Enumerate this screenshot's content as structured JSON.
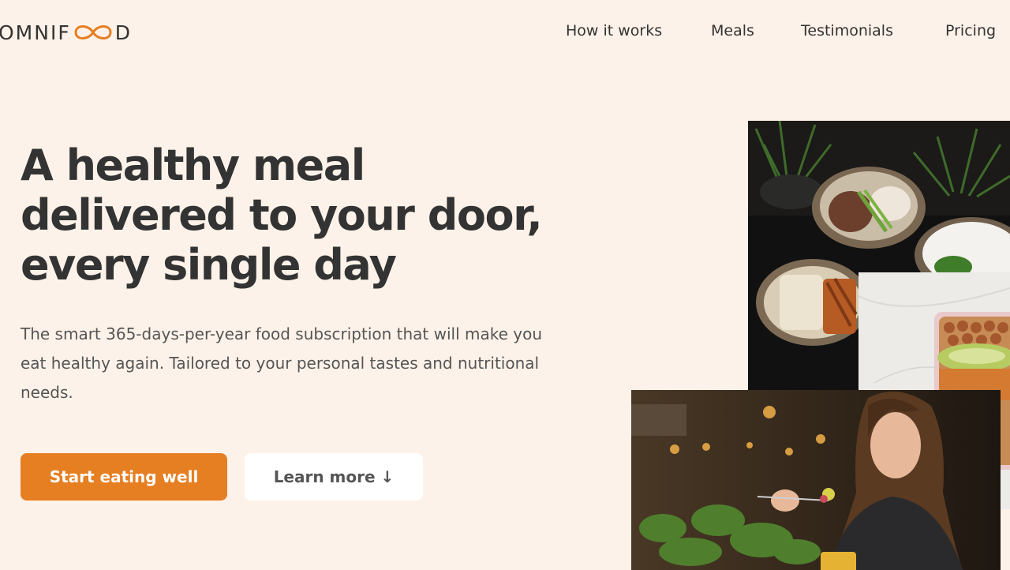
{
  "header": {
    "logo": {
      "prefix": "OMNIF",
      "suffix": "D",
      "mark_icon": "infinity-icon",
      "accent_color": "#e67e22"
    },
    "nav": [
      {
        "label": "How it works"
      },
      {
        "label": "Meals"
      },
      {
        "label": "Testimonials"
      },
      {
        "label": "Pricing"
      }
    ]
  },
  "hero": {
    "title": "A healthy meal delivered to your door, every single day",
    "description": "The smart 365-days-per-year food subscription that will make you eat healthy again. Tailored to your personal tastes and nutritional needs.",
    "primary_button": "Start eating well",
    "secondary_button": "Learn more ↓"
  },
  "colors": {
    "background": "#fdf2e9",
    "accent": "#e67e22",
    "text": "#333333"
  }
}
